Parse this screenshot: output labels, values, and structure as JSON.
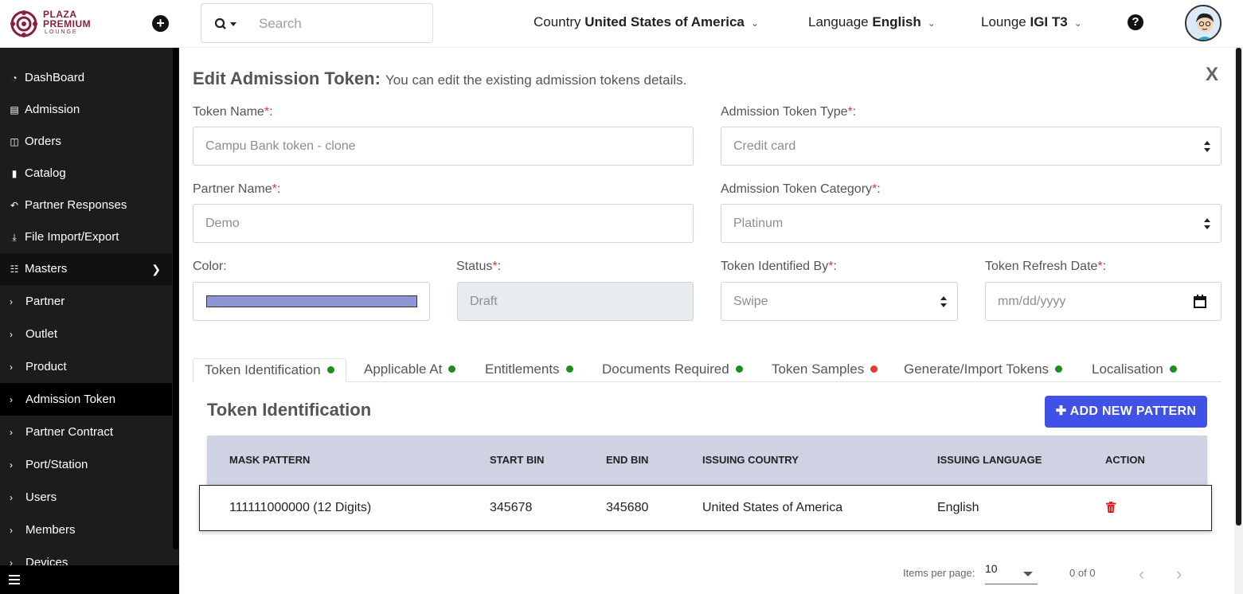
{
  "brand": {
    "line1": "PLAZA",
    "line2": "PREMIUM",
    "line3": "LOUNGE",
    "color": "#8a1e3c"
  },
  "search": {
    "placeholder": "Search"
  },
  "header": {
    "country_label": "Country",
    "country_value": "United States of America",
    "language_label": "Language",
    "language_value": "English",
    "lounge_label": "Lounge",
    "lounge_value": "IGI T3"
  },
  "sidebar": {
    "items": [
      {
        "label": "DashBoard",
        "icon": "dashboard-icon"
      },
      {
        "label": "Admission",
        "icon": "id-card-icon"
      },
      {
        "label": "Orders",
        "icon": "cart-icon"
      },
      {
        "label": "Catalog",
        "icon": "file-icon"
      },
      {
        "label": "Partner Responses",
        "icon": "reply-all-icon"
      },
      {
        "label": "File Import/Export",
        "icon": "download-icon"
      },
      {
        "label": "Masters",
        "icon": "sitemap-icon"
      }
    ],
    "sub_items": [
      "Partner",
      "Outlet",
      "Product",
      "Admission Token",
      "Partner Contract",
      "Port/Station",
      "Users",
      "Members",
      "Devices"
    ],
    "active_sub": "Admission Token"
  },
  "form": {
    "title": "Edit Admission Token:",
    "subtitle": "You can edit the existing admission tokens details.",
    "close_label": "X",
    "token_name_label": "Token Name",
    "token_name_value": "Campu Bank token - clone",
    "token_type_label": "Admission Token Type",
    "token_type_value": "Credit card",
    "partner_label": "Partner Name",
    "partner_value": "Demo",
    "category_label": "Admission Token Category",
    "category_value": "Platinum",
    "color_label": "Color",
    "color_value": "#8e96d6",
    "status_label": "Status",
    "status_value": "Draft",
    "identified_label": "Token Identified By",
    "identified_value": "Swipe",
    "refresh_label": "Token Refresh Date",
    "refresh_placeholder": "mm/dd/yyyy",
    "required_mark": "*",
    "colon": ":"
  },
  "tabs": [
    {
      "label": "Token Identification",
      "status": "#1e8e1e"
    },
    {
      "label": "Applicable At",
      "status": "#1e8e1e"
    },
    {
      "label": "Entitlements",
      "status": "#1e8e1e"
    },
    {
      "label": "Documents Required",
      "status": "#1e8e1e"
    },
    {
      "label": "Token Samples",
      "status": "#e53935"
    },
    {
      "label": "Generate/Import Tokens",
      "status": "#1e8e1e"
    },
    {
      "label": "Localisation",
      "status": "#1e8e1e"
    }
  ],
  "section": {
    "title": "Token Identification",
    "add_button": "ADD NEW PATTERN"
  },
  "table": {
    "columns": [
      "MASK PATTERN",
      "START BIN",
      "END BIN",
      "ISSUING COUNTRY",
      "ISSUING LANGUAGE",
      "ACTION"
    ],
    "rows": [
      {
        "mask": "111111000000 (12 Digits)",
        "start": "345678",
        "end": "345680",
        "country": "United States of America",
        "language": "English"
      }
    ]
  },
  "pager": {
    "items_label": "Items per page:",
    "page_size": "10",
    "range": "0 of 0"
  },
  "accent_color": "#3f51e6"
}
